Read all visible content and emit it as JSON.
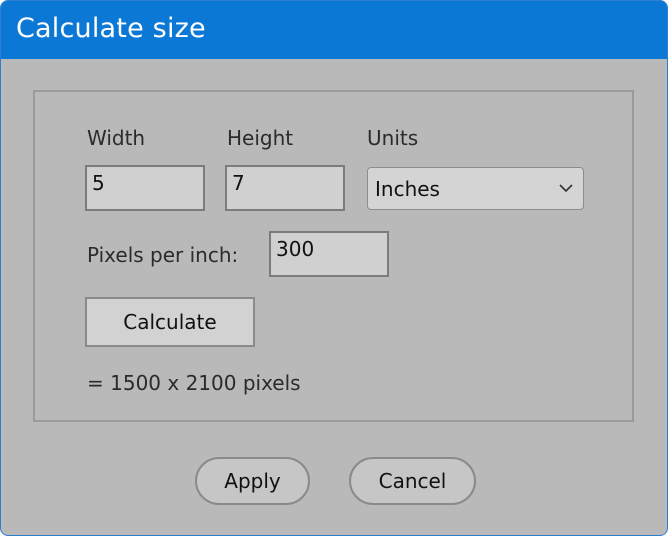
{
  "window": {
    "title": "Calculate size"
  },
  "form": {
    "width_label": "Width",
    "height_label": "Height",
    "units_label": "Units",
    "width_value": "5",
    "height_value": "7",
    "units_value": "Inches",
    "ppi_label": "Pixels per inch:",
    "ppi_value": "300",
    "calculate_label": "Calculate",
    "result_text": "= 1500 x 2100 pixels"
  },
  "footer": {
    "apply_label": "Apply",
    "cancel_label": "Cancel"
  },
  "icons": {
    "units_dropdown": "chevron-down-icon"
  },
  "colors": {
    "titlebar": "#0a78d4",
    "dialog_bg": "#b9b9b9"
  }
}
